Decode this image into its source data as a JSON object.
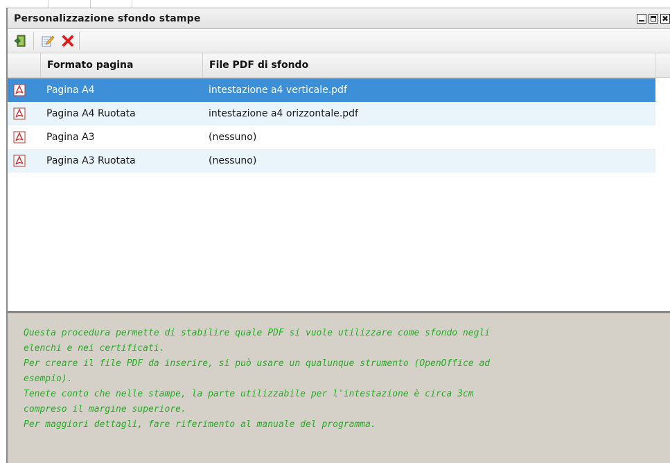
{
  "window": {
    "title": "Personalizzazione sfondo stampe",
    "controls": [
      "minimize-icon",
      "maximize-icon",
      "close-icon"
    ],
    "close_glyph": "✖"
  },
  "toolbar": {
    "buttons": [
      {
        "name": "exit",
        "icon": "exit-door-icon"
      },
      {
        "name": "edit",
        "icon": "edit-pencil-icon"
      },
      {
        "name": "delete",
        "icon": "delete-x-icon"
      }
    ]
  },
  "grid": {
    "columns": [
      "Formato pagina",
      "File PDF di sfondo"
    ],
    "rows": [
      {
        "format": "Pagina A4",
        "file": "intestazione a4 verticale.pdf",
        "selected": true
      },
      {
        "format": "Pagina A4 Ruotata",
        "file": "intestazione a4 orizzontale.pdf",
        "selected": false
      },
      {
        "format": "Pagina A3",
        "file": "(nessuno)",
        "selected": false
      },
      {
        "format": "Pagina A3 Ruotata",
        "file": "(nessuno)",
        "selected": false
      }
    ],
    "row_icon": "pdf-icon"
  },
  "info": {
    "lines": [
      "Questa procedura permette di stabilire quale PDF si vuole utilizzare come sfondo negli",
      "elenchi e nei certificati.",
      "Per creare il file PDF da inserire, si può usare un qualunque strumento (OpenOffice ad",
      "esempio).",
      "Tenete conto che nelle stampe, la parte utilizzabile per l'intestazione è circa 3cm",
      "compreso il margine superiore.",
      "Per maggiori dettagli, fare riferimento al manuale del programma."
    ]
  },
  "colors": {
    "selected_row": "#3d8fd7",
    "alt_row": "#e9f4fb",
    "info_text": "#20b020",
    "info_bg": "#d5d1c8"
  }
}
